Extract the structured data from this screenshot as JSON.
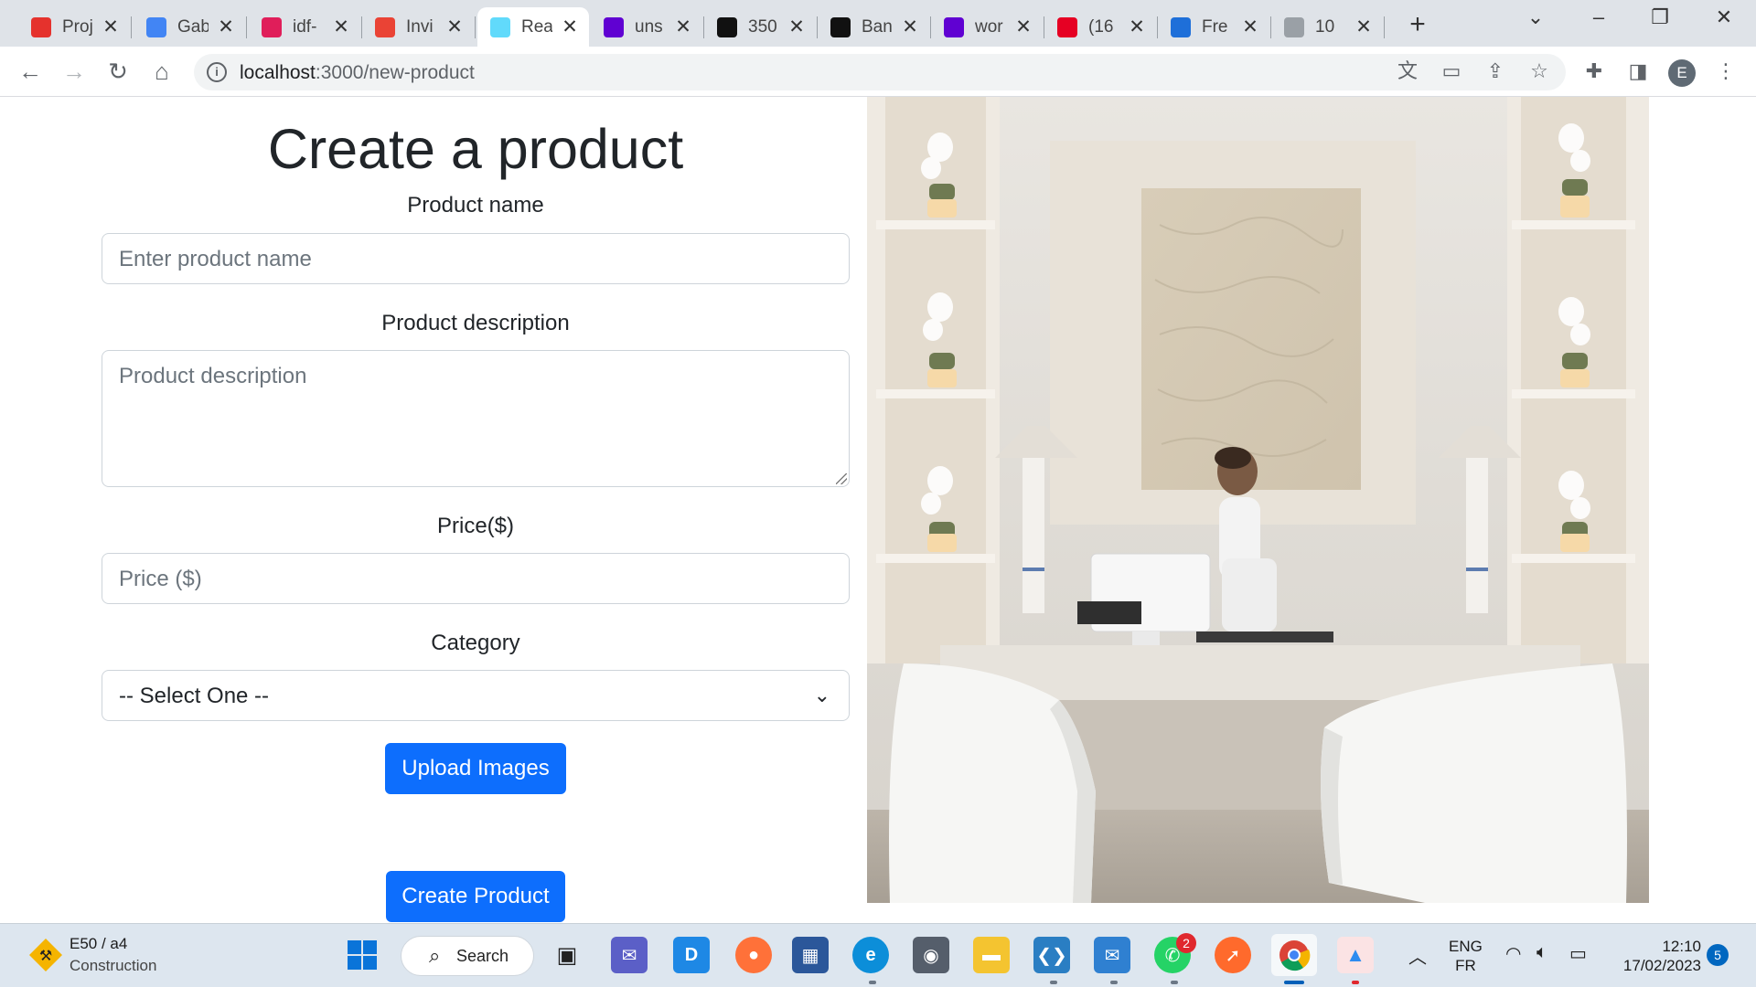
{
  "browser": {
    "tabs": [
      {
        "title": "Proj",
        "icon": "red-seahorse-icon",
        "color": "#e5322d"
      },
      {
        "title": "Gab",
        "icon": "google-docs-icon",
        "color": "#4285f4"
      },
      {
        "title": "idf-",
        "icon": "slack-icon",
        "color": "#e01e5a"
      },
      {
        "title": "Invi",
        "icon": "gmail-icon",
        "color": "#ea4335"
      },
      {
        "title": "Rea",
        "icon": "react-icon",
        "color": "#61dafb",
        "active": true
      },
      {
        "title": "uns",
        "icon": "yahoo-icon",
        "color": "#6001d2"
      },
      {
        "title": "350",
        "icon": "unsplash-icon",
        "color": "#111111"
      },
      {
        "title": "Ban",
        "icon": "istock-icon",
        "color": "#111111"
      },
      {
        "title": "wor",
        "icon": "yahoo-icon",
        "color": "#6001d2"
      },
      {
        "title": "(16",
        "icon": "pinterest-icon",
        "color": "#e60023"
      },
      {
        "title": "Fre",
        "icon": "ph-icon",
        "color": "#1e6fd9"
      },
      {
        "title": "10",
        "icon": "image-icon",
        "color": "#9aa0a6"
      }
    ],
    "url_host": "localhost",
    "url_path": ":3000/new-product",
    "profile_initial": "E"
  },
  "form": {
    "title": "Create a product",
    "name_label": "Product name",
    "name_placeholder": "Enter product name",
    "description_label": "Product description",
    "description_placeholder": "Product description",
    "price_label": "Price($)",
    "price_placeholder": "Price ($)",
    "category_label": "Category",
    "category_selected": "-- Select One --",
    "upload_label": "Upload Images",
    "submit_label": "Create Product"
  },
  "colors": {
    "primary": "#0d6efd",
    "text": "#212529",
    "placeholder": "#6c757d",
    "border": "#ced4da"
  },
  "taskbar": {
    "weather_line1": "E50 / a4",
    "weather_line2": "Construction",
    "search_label": "Search",
    "whatsapp_badge": "2",
    "lang_line1": "ENG",
    "lang_line2": "FR",
    "time": "12:10",
    "date": "17/02/2023",
    "notifications": "5"
  }
}
